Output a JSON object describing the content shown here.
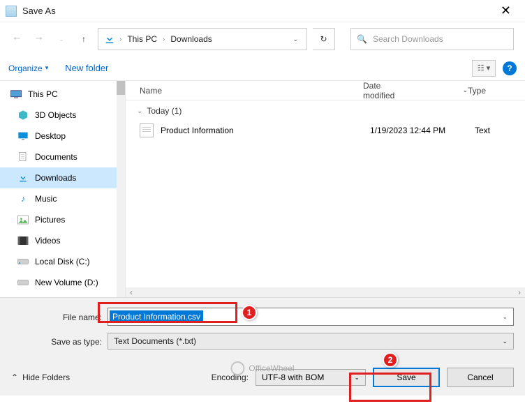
{
  "window": {
    "title": "Save As"
  },
  "breadcrumb": {
    "item1": "This PC",
    "item2": "Downloads"
  },
  "search": {
    "placeholder": "Search Downloads"
  },
  "toolbar": {
    "organize": "Organize",
    "newfolder": "New folder"
  },
  "sidebar": {
    "root": "This PC",
    "items": [
      "3D Objects",
      "Desktop",
      "Documents",
      "Downloads",
      "Music",
      "Pictures",
      "Videos",
      "Local Disk (C:)",
      "New Volume (D:)"
    ]
  },
  "columns": {
    "name": "Name",
    "date": "Date modified",
    "type": "Type"
  },
  "group": {
    "label": "Today (1)"
  },
  "file": {
    "name": "Product Information",
    "date": "1/19/2023 12:44 PM",
    "type": "Text"
  },
  "form": {
    "filename_label": "File name:",
    "filename_value": "Product Information.csv",
    "type_label": "Save as type:",
    "type_value": "Text Documents (*.txt)",
    "encoding_label": "Encoding:",
    "encoding_value": "UTF-8 with BOM",
    "hide_folders": "Hide Folders",
    "save": "Save",
    "cancel": "Cancel"
  },
  "annotations": {
    "b1": "1",
    "b2": "2"
  },
  "watermark": "OfficeWheel"
}
